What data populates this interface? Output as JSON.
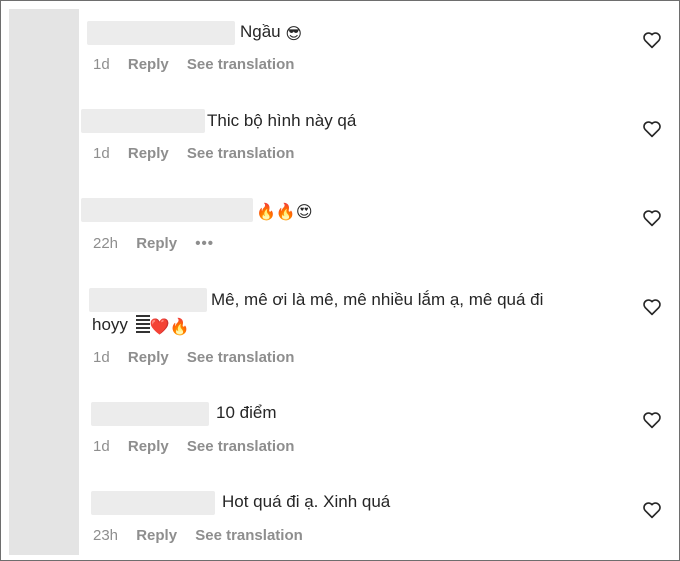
{
  "comments": [
    {
      "text": "Ngầu",
      "emojis": [
        "😎"
      ],
      "time": "1d",
      "reply": "Reply",
      "translate": "See translation"
    },
    {
      "text": "Thic bộ hình này qá",
      "emojis": [],
      "time": "1d",
      "reply": "Reply",
      "translate": "See translation"
    },
    {
      "text": "",
      "emojis": [
        "🔥",
        "🔥",
        "😍"
      ],
      "time": "22h",
      "reply": "Reply",
      "more": "•••"
    },
    {
      "text_line1": "Mê, mê ơi là mê, mê nhiều lắm ạ, mê quá đi",
      "text_line2": "hoyy",
      "emojis": [
        "❤️",
        "🔥"
      ],
      "time": "1d",
      "reply": "Reply",
      "translate": "See translation"
    },
    {
      "text": "10 điểm",
      "emojis": [],
      "time": "1d",
      "reply": "Reply",
      "translate": "See translation"
    },
    {
      "text": "Hot quá đi ạ. Xinh quá",
      "emojis": [],
      "time": "23h",
      "reply": "Reply",
      "translate": "See translation"
    }
  ],
  "icons": {
    "like": "heart-icon",
    "more": "more-options-icon",
    "smile": "sunglasses-emoji",
    "fire": "fire-emoji",
    "love": "heart-eyes-emoji",
    "red_heart": "red-heart-emoji",
    "bars": "text-bars-emoji"
  },
  "colors": {
    "text": "#262626",
    "meta": "#8e8e8e",
    "avatar": "#e4e4e4",
    "blur": "#ececec",
    "border": "#6e6e6e"
  }
}
